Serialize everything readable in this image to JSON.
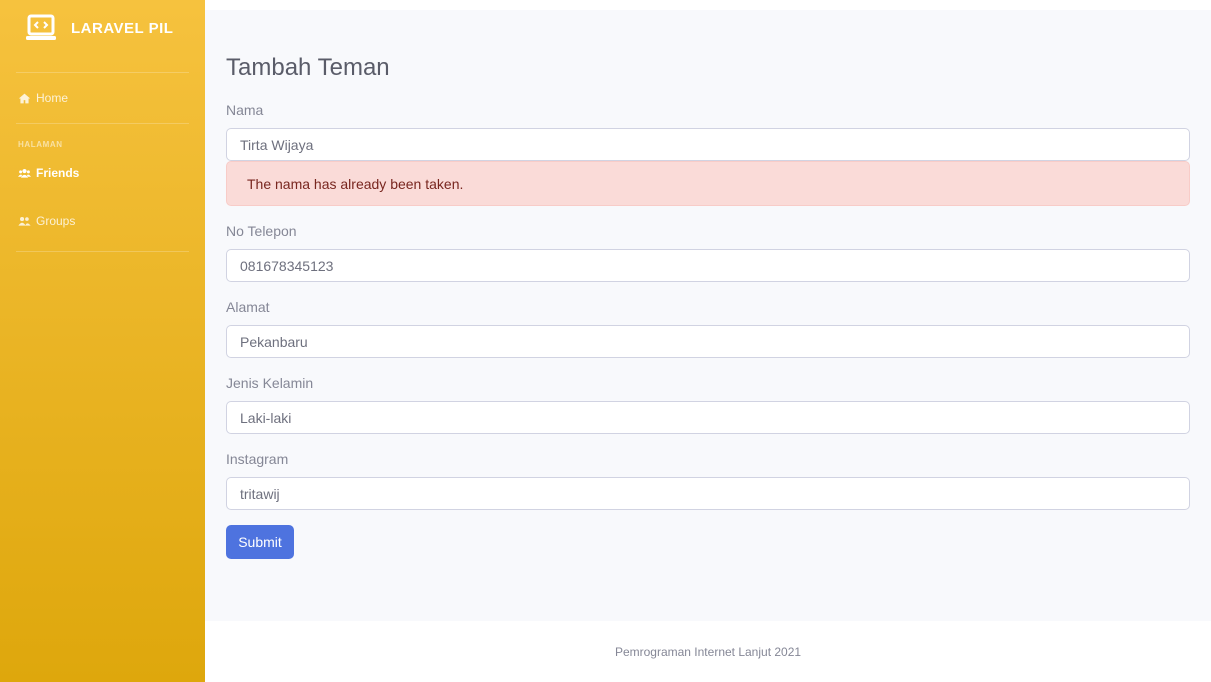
{
  "sidebar": {
    "brand": "LARAVEL PIL",
    "brand_icon": "laptop-code-icon",
    "home_label": "Home",
    "home_icon": "home-icon",
    "heading": "HALAMAN",
    "items": [
      {
        "label": "Friends",
        "icon": "users-icon",
        "active": true
      },
      {
        "label": "Groups",
        "icon": "user-friends-icon",
        "active": false
      }
    ]
  },
  "main": {
    "title": "Tambah Teman",
    "fields": {
      "nama": {
        "label": "Nama",
        "value": "Tirta Wijaya",
        "error": "The nama has already been taken."
      },
      "telepon": {
        "label": "No Telepon",
        "value": "081678345123"
      },
      "alamat": {
        "label": "Alamat",
        "value": "Pekanbaru"
      },
      "jenis_kelamin": {
        "label": "Jenis Kelamin",
        "value": "Laki-laki"
      },
      "instagram": {
        "label": "Instagram",
        "value": "tritawij"
      }
    },
    "submit_label": "Submit"
  },
  "footer": {
    "text": "Pemrograman Internet Lanjut 2021"
  },
  "colors": {
    "sidebar_top": "#f6c23e",
    "sidebar_bottom": "#dea70c",
    "primary": "#4e73df",
    "alert_bg": "#fadbd8",
    "alert_text": "#78261f"
  }
}
